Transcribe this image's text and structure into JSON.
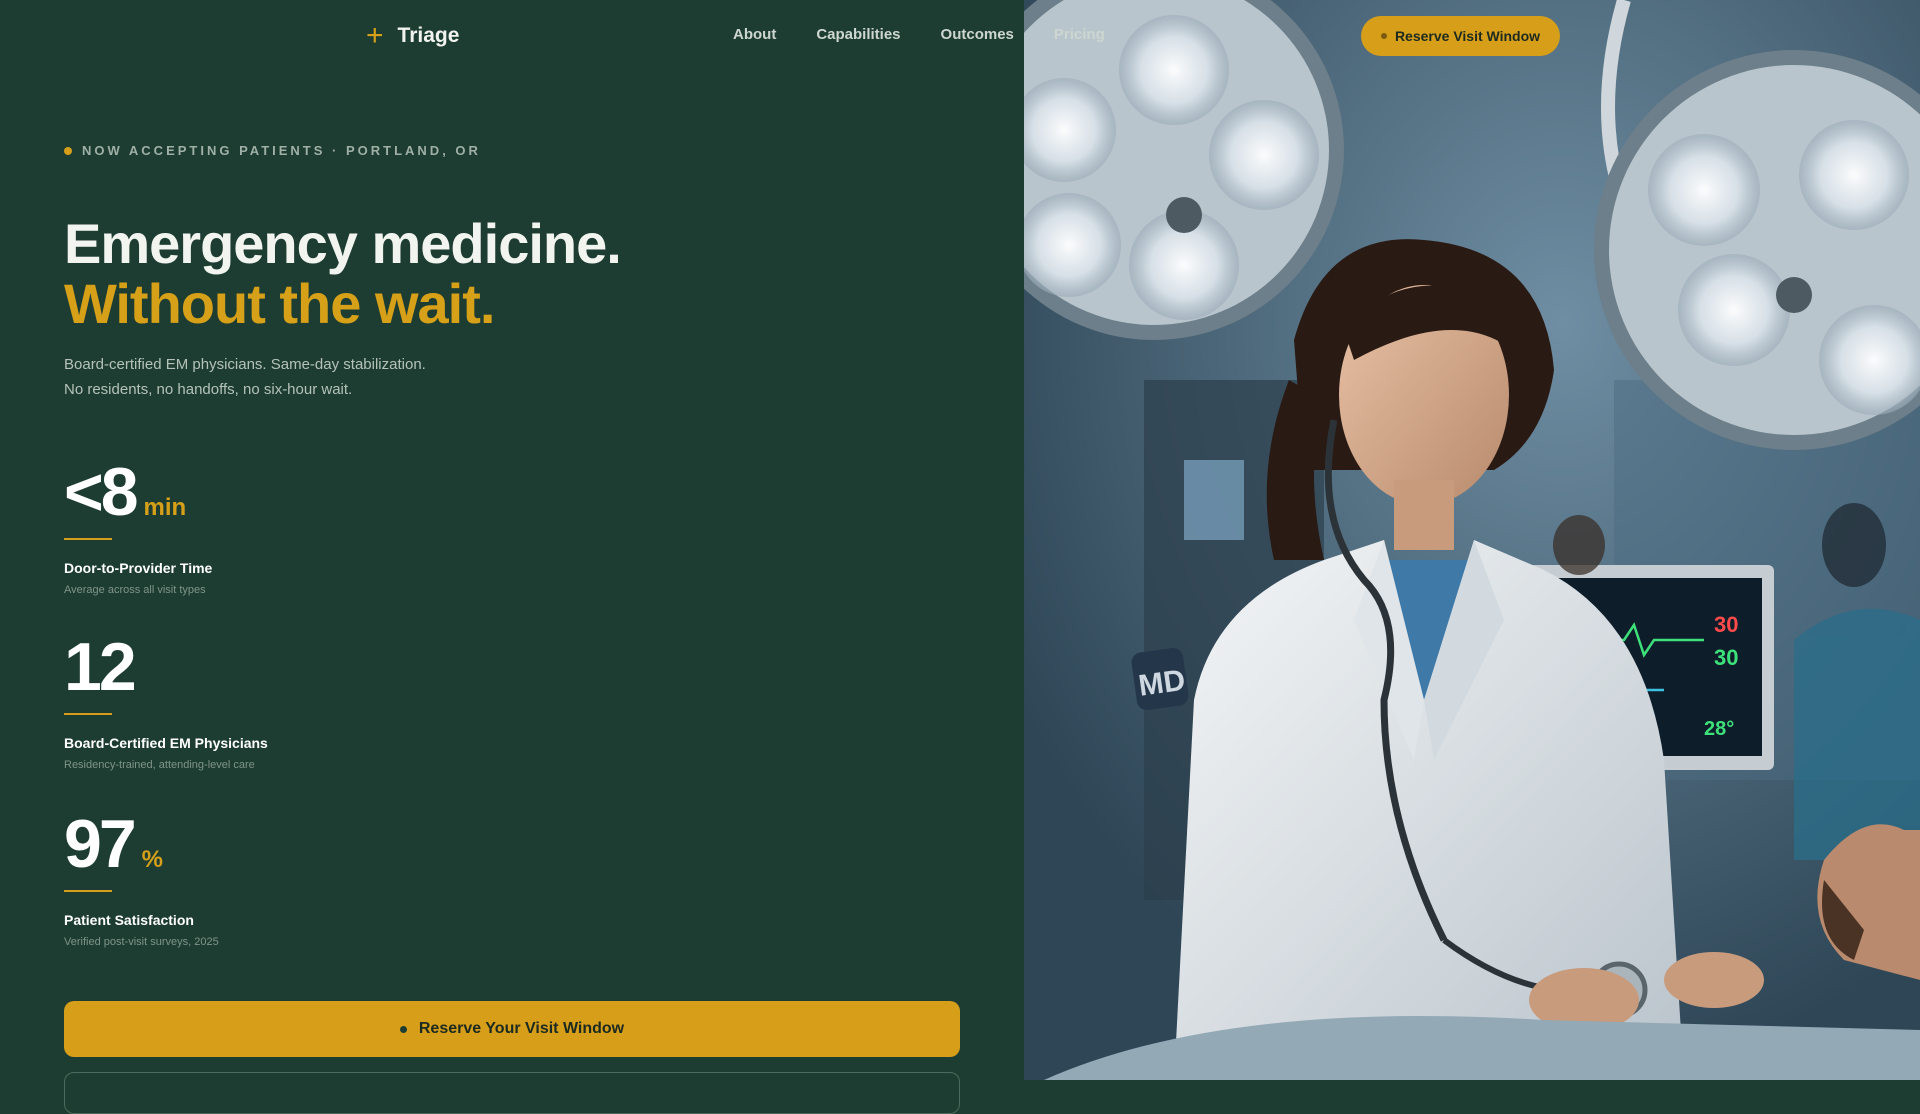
{
  "header": {
    "brand_mark": "+",
    "brand_name": "Triage",
    "nav": [
      "About",
      "Capabilities",
      "Outcomes",
      "Pricing"
    ],
    "cta_label": "Reserve Visit Window"
  },
  "hero": {
    "eyebrow": "NOW ACCEPTING PATIENTS · PORTLAND, OR",
    "headline_line1": "Emergency medicine.",
    "headline_line2": "Without the wait.",
    "subtext_line1": "Board-certified EM physicians. Same-day stabilization.",
    "subtext_line2": "No residents, no handoffs, no six-hour wait."
  },
  "stats": [
    {
      "value": "<8",
      "unit": "min",
      "label": "Door-to-Provider Time",
      "note": "Average across all visit types"
    },
    {
      "value": "12",
      "unit": "",
      "label": "Board-Certified EM Physicians",
      "note": "Residency-trained, attending-level care"
    },
    {
      "value": "97",
      "unit": "%",
      "label": "Patient Satisfaction",
      "note": "Verified post-visit surveys, 2025"
    }
  ],
  "cta": {
    "primary_label": "Reserve Your Visit Window"
  },
  "image": {
    "badge_text": "MD",
    "monitor_readings": [
      "30",
      "30",
      "28°"
    ]
  },
  "colors": {
    "background": "#1e3d32",
    "accent": "#d69e19",
    "headline": "#f2f4f0"
  }
}
